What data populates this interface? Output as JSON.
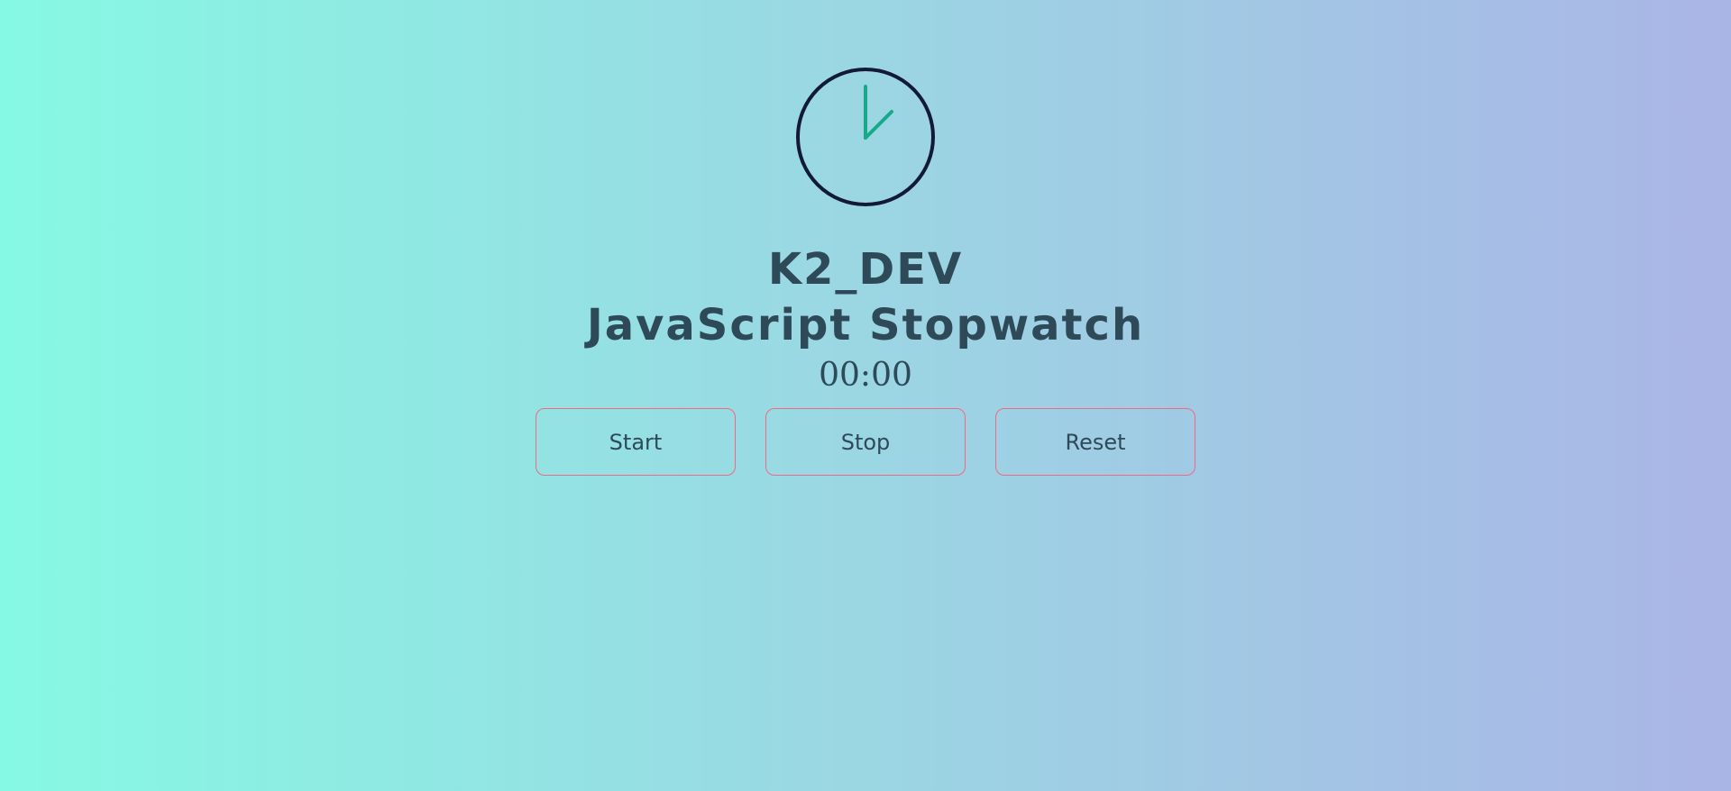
{
  "header": {
    "icon": "clock-icon",
    "title_line1": "K2_DEV",
    "title_line2": "JavaScript Stopwatch"
  },
  "timer": {
    "display": "00:00"
  },
  "controls": {
    "start_label": "Start",
    "stop_label": "Stop",
    "reset_label": "Reset"
  },
  "colors": {
    "background_left": "#86f9e3",
    "background_right": "#aab5e6",
    "clock_outline": "#121a36",
    "clock_hands": "#17aa8a",
    "text": "#2e4a59",
    "button_border": "#f06a85"
  }
}
